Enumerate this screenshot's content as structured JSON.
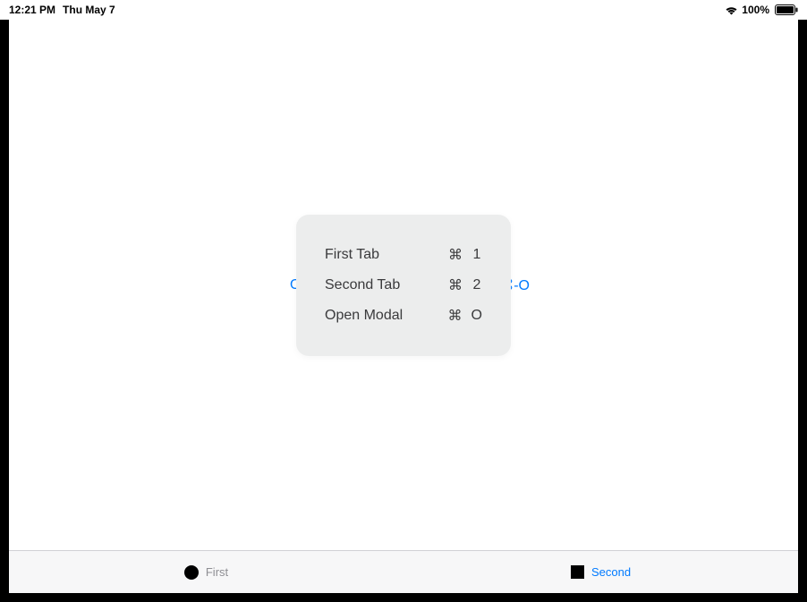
{
  "status_bar": {
    "time": "12:21 PM",
    "date": "Thu May 7",
    "battery_pct": "100%"
  },
  "background_links": {
    "left_partial": "Ope",
    "right_partial": "⌘-O"
  },
  "shortcuts": {
    "items": [
      {
        "label": "First Tab",
        "modifier": "⌘",
        "key": "1"
      },
      {
        "label": "Second Tab",
        "modifier": "⌘",
        "key": "2"
      },
      {
        "label": "Open Modal",
        "modifier": "⌘",
        "key": "O"
      }
    ]
  },
  "tab_bar": {
    "items": [
      {
        "label": "First",
        "active": false,
        "icon": "circle"
      },
      {
        "label": "Second",
        "active": true,
        "icon": "square"
      }
    ]
  }
}
